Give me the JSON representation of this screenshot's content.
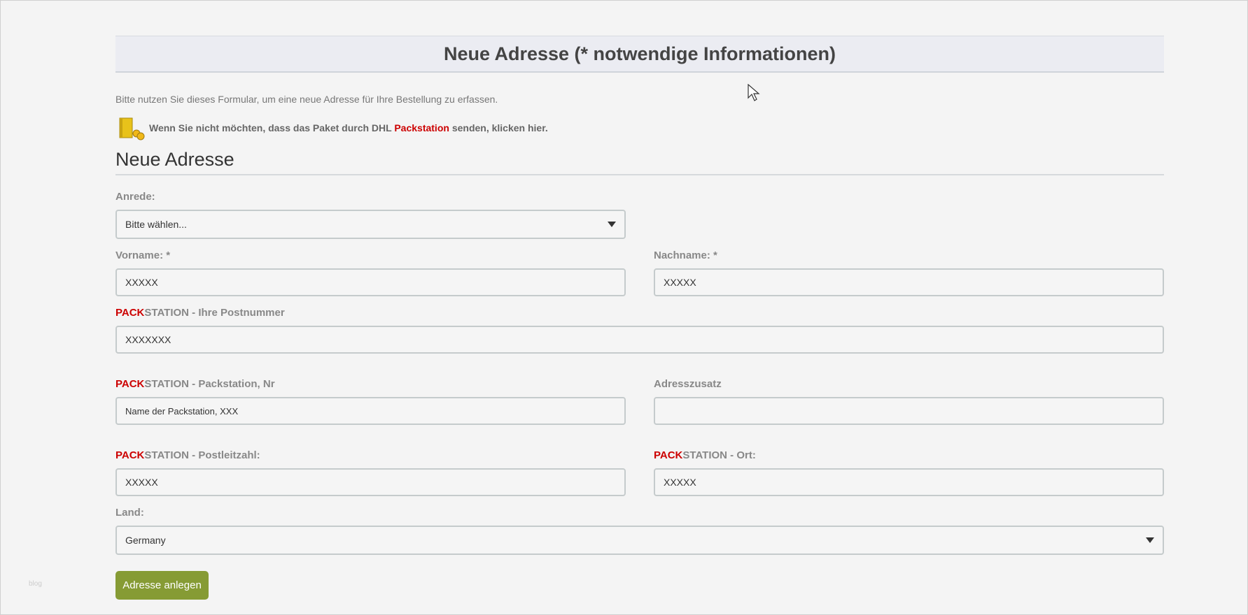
{
  "header": {
    "title": "Neue Adresse (* notwendige Informationen)"
  },
  "intro": "Bitte nutzen Sie dieses Formular, um eine neue Adresse für Ihre Bestellung zu erfassen.",
  "packstation_notice": {
    "before": "Wenn Sie nicht möchten, dass das Paket durch DHL ",
    "link": "Packstation",
    "after": " senden, klicken hier.",
    "icon": "packstation-icon"
  },
  "section_title": "Neue Adresse",
  "fields": {
    "anrede": {
      "label": "Anrede:",
      "value": "Bitte wählen..."
    },
    "vorname": {
      "label": "Vorname: *",
      "value": "XXXXX"
    },
    "nachname": {
      "label": "Nachname: *",
      "value": "XXXXX"
    },
    "postnummer": {
      "label_red": "PACK",
      "label_rest": "STATION - Ihre Postnummer",
      "value": "XXXXXXX"
    },
    "packstation_nr": {
      "label_red": "PACK",
      "label_rest": "STATION - Packstation, Nr",
      "value": "Name der Packstation, XXX"
    },
    "adresszusatz": {
      "label": "Adresszusatz",
      "value": ""
    },
    "plz": {
      "label_red": "PACK",
      "label_rest": "STATION - Postleitzahl:",
      "value": "XXXXX"
    },
    "ort": {
      "label_red": "PACK",
      "label_rest": "STATION - Ort:",
      "value": "XXXXX"
    },
    "land": {
      "label": "Land:",
      "value": "Germany"
    }
  },
  "submit_label": "Adresse anlegen",
  "footer_text": "blog",
  "colors": {
    "accent_red": "#cc0000",
    "button_green": "#869b34"
  }
}
